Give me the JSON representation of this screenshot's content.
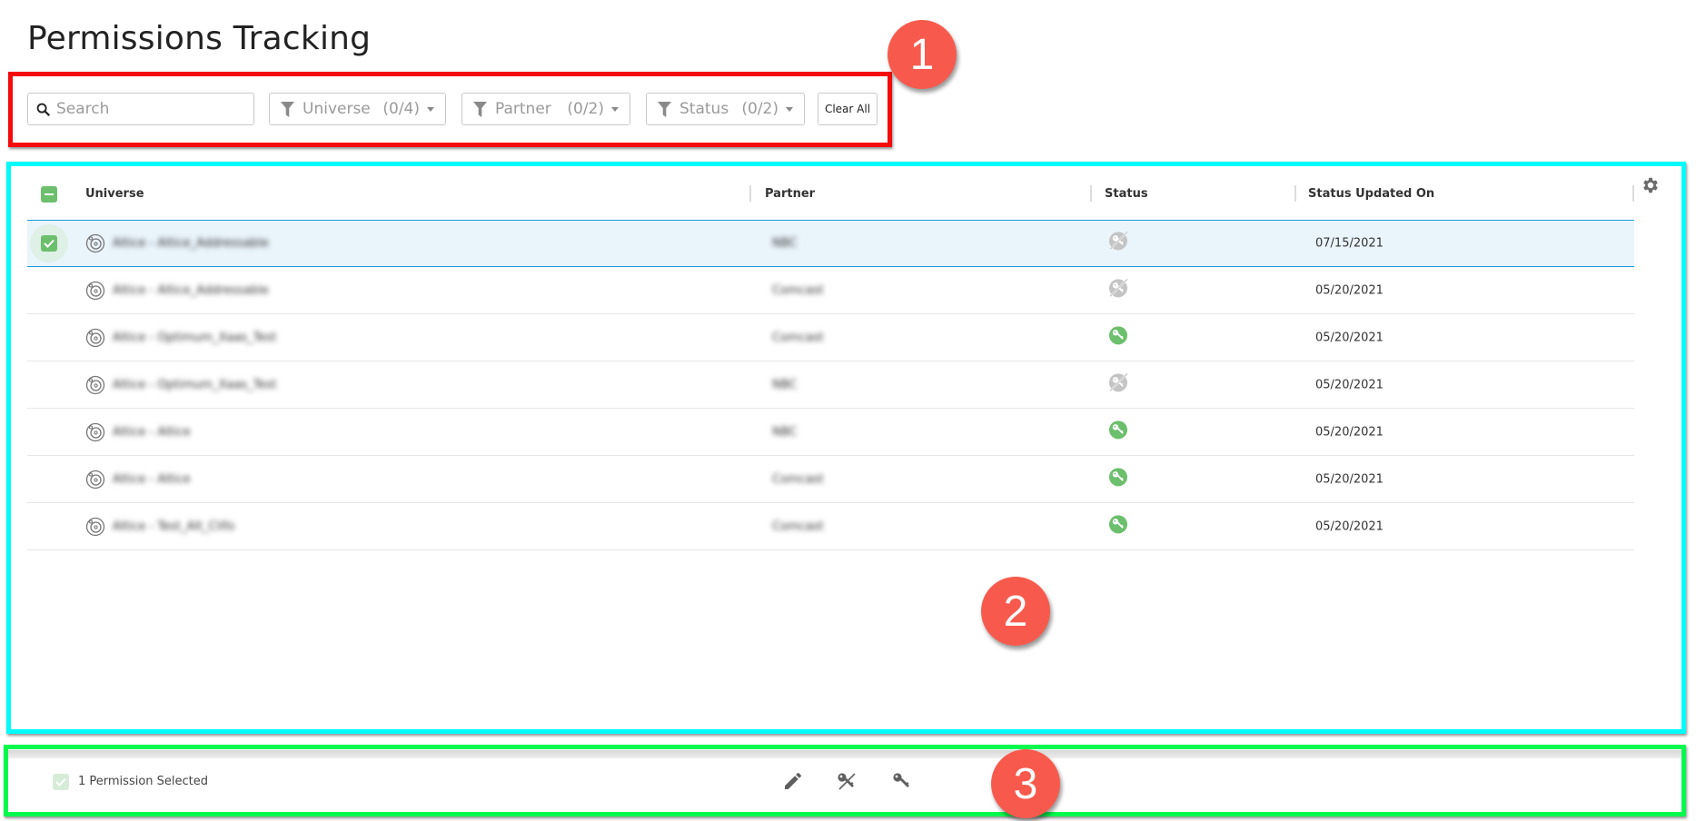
{
  "page": {
    "title": "Permissions Tracking"
  },
  "annotations": {
    "badge_1": "1",
    "badge_2": "2",
    "badge_3": "3"
  },
  "filters": {
    "search": {
      "placeholder": "Search",
      "value": "",
      "icon": "search-icon"
    },
    "universe": {
      "label": "Universe",
      "count": "(0/4)",
      "icon": "filter-icon"
    },
    "partner": {
      "label": "Partner",
      "count": "(0/2)",
      "icon": "filter-icon"
    },
    "status": {
      "label": "Status",
      "count": "(0/2)",
      "icon": "filter-icon"
    },
    "clear_all_label": "Clear All"
  },
  "table": {
    "columns": [
      "Universe",
      "Partner",
      "Status",
      "Status Updated On"
    ],
    "settings_icon": "gear-icon",
    "header_checkbox_state": "indeterminate",
    "rows": [
      {
        "universe": "Altice - Altice_Addressable",
        "partner": "NBC",
        "status": "revoked",
        "updated": "07/15/2021",
        "selected": true
      },
      {
        "universe": "Altice - Altice_Addressable",
        "partner": "Comcast",
        "status": "revoked",
        "updated": "05/20/2021",
        "selected": false
      },
      {
        "universe": "Altice - Optimum_Xaas_Test",
        "partner": "Comcast",
        "status": "granted",
        "updated": "05/20/2021",
        "selected": false
      },
      {
        "universe": "Altice - Optimum_Xaas_Test",
        "partner": "NBC",
        "status": "revoked",
        "updated": "05/20/2021",
        "selected": false
      },
      {
        "universe": "Altice - Altice",
        "partner": "NBC",
        "status": "granted",
        "updated": "05/20/2021",
        "selected": false
      },
      {
        "universe": "Altice - Altice",
        "partner": "Comcast",
        "status": "granted",
        "updated": "05/20/2021",
        "selected": false
      },
      {
        "universe": "Altice - Test_Alt_Clifo",
        "partner": "Comcast",
        "status": "granted",
        "updated": "05/20/2021",
        "selected": false
      }
    ]
  },
  "footer": {
    "selection_label": "1 Permission Selected",
    "actions": [
      {
        "name": "edit",
        "icon": "pencil-icon"
      },
      {
        "name": "revoke",
        "icon": "key-off-icon"
      },
      {
        "name": "grant",
        "icon": "key-icon"
      }
    ]
  },
  "colors": {
    "accent_green": "#6cbf6c",
    "status_revoked": "#c4c4c4",
    "selected_row_bg": "#eaf4fb",
    "selected_row_border": "#1b9ad6",
    "annotation_red": "#f50b0b",
    "annotation_cyan": "#00fbfb",
    "annotation_green": "#04f94e",
    "badge": "#f75a4d"
  }
}
